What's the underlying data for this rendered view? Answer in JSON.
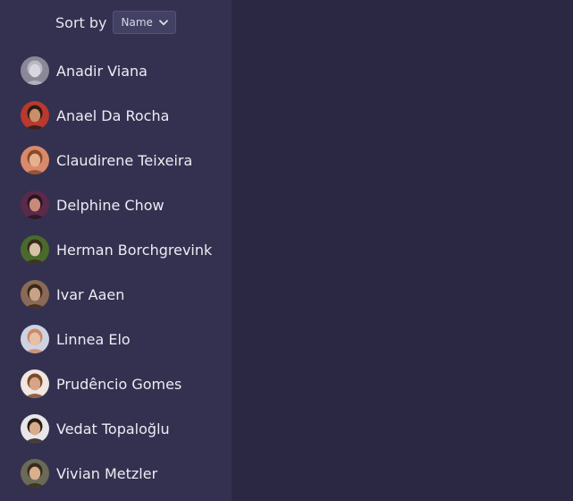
{
  "sidebar": {
    "sort_label": "Sort by",
    "sort_value": "Name",
    "people": [
      {
        "name": "Anadir Viana",
        "avatar_bg": "#8a8898",
        "avatar_fg": "#d8d6df",
        "avatar_hair": "#b9b7c4"
      },
      {
        "name": "Anael Da Rocha",
        "avatar_bg": "#b8392d",
        "avatar_fg": "#c98e6a",
        "avatar_hair": "#2a1c14"
      },
      {
        "name": "Claudirene Teixeira",
        "avatar_bg": "#d98a6a",
        "avatar_fg": "#e7b08f",
        "avatar_hair": "#8a4a2a"
      },
      {
        "name": "Delphine Chow",
        "avatar_bg": "#5a2a48",
        "avatar_fg": "#c98a7a",
        "avatar_hair": "#2a1424"
      },
      {
        "name": "Herman Borchgrevink",
        "avatar_bg": "#4a6a2c",
        "avatar_fg": "#d7c2a6",
        "avatar_hair": "#3a2a1c"
      },
      {
        "name": "Ivar Aaen",
        "avatar_bg": "#8a6a56",
        "avatar_fg": "#c7a288",
        "avatar_hair": "#3a2818"
      },
      {
        "name": "Linnea Elo",
        "avatar_bg": "#cfd2e2",
        "avatar_fg": "#e5c0a8",
        "avatar_hair": "#c98a68"
      },
      {
        "name": "Prudêncio Gomes",
        "avatar_bg": "#f1e6e0",
        "avatar_fg": "#d9a486",
        "avatar_hair": "#7a4a2c"
      },
      {
        "name": "Vedat Topaloğlu",
        "avatar_bg": "#e9e6ea",
        "avatar_fg": "#d7ab8c",
        "avatar_hair": "#2a1c14"
      },
      {
        "name": "Vivian Metzler",
        "avatar_bg": "#6a6a58",
        "avatar_fg": "#d8b08e",
        "avatar_hair": "#3a2a1c"
      }
    ]
  }
}
